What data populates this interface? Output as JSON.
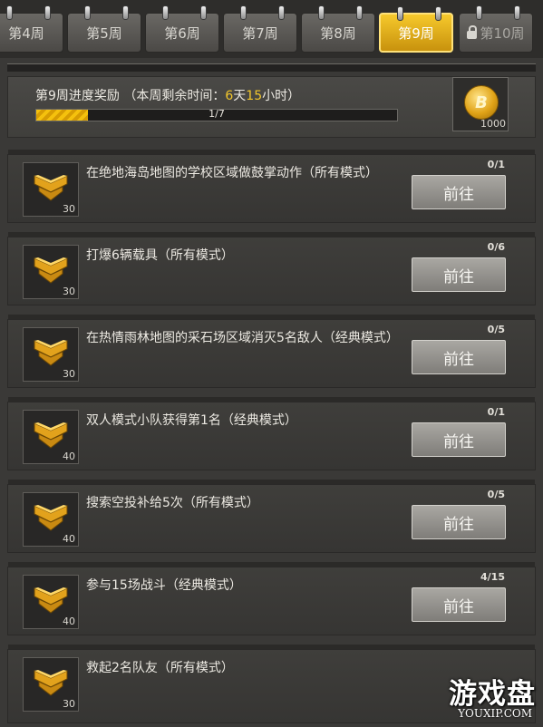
{
  "tabs": [
    {
      "label": "第4周",
      "active": false,
      "locked": false
    },
    {
      "label": "第5周",
      "active": false,
      "locked": false
    },
    {
      "label": "第6周",
      "active": false,
      "locked": false
    },
    {
      "label": "第7周",
      "active": false,
      "locked": false
    },
    {
      "label": "第8周",
      "active": false,
      "locked": false
    },
    {
      "label": "第9周",
      "active": true,
      "locked": false
    },
    {
      "label": "第10周",
      "active": false,
      "locked": true
    }
  ],
  "header": {
    "title_prefix": "第9周进度奖励 （本周剩余时间：",
    "days": "6",
    "days_unit": "天",
    "hours": "15",
    "hours_unit": "小时）",
    "progress_text": "1/7",
    "progress_fraction": 0.143,
    "reward_count": "1000"
  },
  "tasks": [
    {
      "text": "在绝地海岛地图的学校区域做鼓掌动作（所有模式）",
      "points": "30",
      "progress": "0/1",
      "button": "前往"
    },
    {
      "text": "打爆6辆载具（所有模式）",
      "points": "30",
      "progress": "0/6",
      "button": "前往"
    },
    {
      "text": "在热情雨林地图的采石场区域消灭5名敌人（经典模式）",
      "points": "30",
      "progress": "0/5",
      "button": "前往"
    },
    {
      "text": "双人模式小队获得第1名（经典模式）",
      "points": "40",
      "progress": "0/1",
      "button": "前往"
    },
    {
      "text": "搜索空投补给5次（所有模式）",
      "points": "40",
      "progress": "0/5",
      "button": "前往"
    },
    {
      "text": "参与15场战斗（经典模式）",
      "points": "40",
      "progress": "4/15",
      "button": "前往"
    },
    {
      "text": "救起2名队友（所有模式）",
      "points": "30",
      "progress": "",
      "button": ""
    }
  ],
  "watermark": {
    "main": "游戏盘",
    "sub": "YOUXIP.COM"
  },
  "colors": {
    "accent": "#f2c62b",
    "active_tab": "#e9b31c",
    "background": "#3a3937"
  },
  "icons": {
    "badge": "chevron-rank-icon",
    "reward": "coin-icon",
    "lock": "lock-icon"
  }
}
